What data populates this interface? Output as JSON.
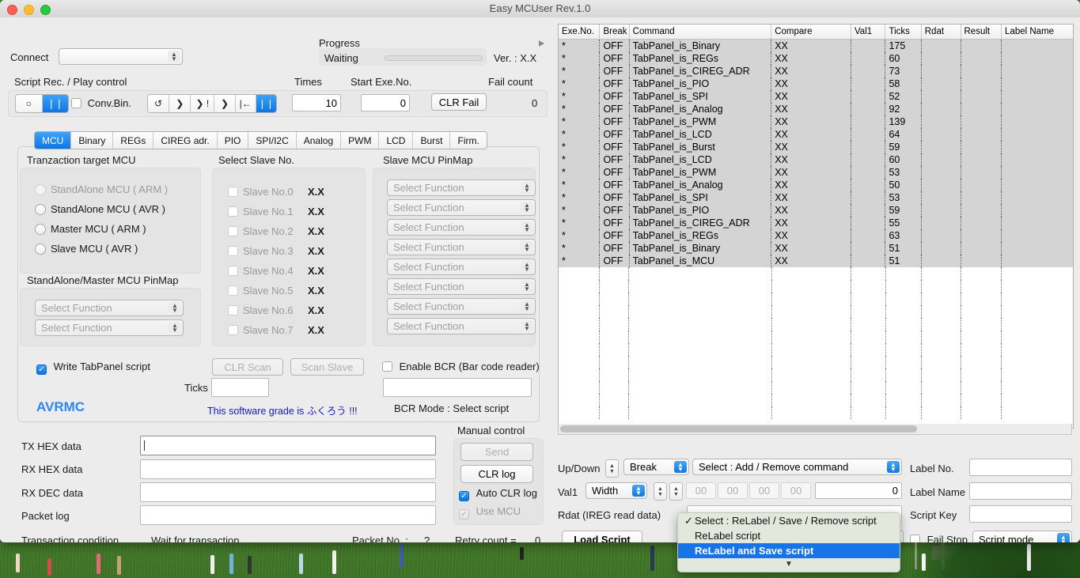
{
  "window": {
    "title": "Easy MCUser Rev.1.0"
  },
  "header": {
    "connect_label": "Connect",
    "connect_value": "",
    "progress_label": "Progress",
    "progress_status": "Waiting",
    "progress_percent": 0,
    "version": "Ver. : X.X",
    "disclosure_icon": "triangle-right-icon",
    "script_section_label": "Script Rec. / Play control",
    "times_label": "Times",
    "times_value": "10",
    "start_exe_label": "Start Exe.No.",
    "start_exe_value": "0",
    "fail_count_label": "Fail count",
    "fail_count_value": "0",
    "clr_fail_label": "CLR Fail",
    "conv_bin_label": "Conv.Bin.",
    "conv_bin_checked": false,
    "rec_segments": [
      "○",
      "❘❘"
    ],
    "rec_selected_index": 1,
    "play_segments": [
      "↺",
      "❯",
      "❯ !",
      "❯",
      "|←",
      "❘❘"
    ],
    "play_selected_index": 5
  },
  "tabs": {
    "items": [
      "MCU",
      "Binary",
      "REGs",
      "CIREG adr.",
      "PIO",
      "SPI/I2C",
      "Analog",
      "PWM",
      "LCD",
      "Burst",
      "Firm."
    ],
    "selected": "MCU"
  },
  "mcu_panel": {
    "target_label": "Tranzaction target MCU",
    "radios": [
      {
        "label": "StandAlone MCU ( ARM )",
        "enabled": false,
        "selected": false
      },
      {
        "label": "StandAlone MCU ( AVR )",
        "enabled": true,
        "selected": false
      },
      {
        "label": "Master MCU ( ARM )",
        "enabled": true,
        "selected": false
      },
      {
        "label": "Slave MCU ( AVR )",
        "enabled": true,
        "selected": false
      }
    ],
    "pinmap_label": "StandAlone/Master MCU PinMap",
    "pinmap_selects": [
      "Select Function",
      "Select Function"
    ],
    "slave_label": "Select Slave No.",
    "slaves": [
      {
        "label": "Slave No.0",
        "value": "X.X"
      },
      {
        "label": "Slave No.1",
        "value": "X.X"
      },
      {
        "label": "Slave No.2",
        "value": "X.X"
      },
      {
        "label": "Slave No.3",
        "value": "X.X"
      },
      {
        "label": "Slave No.4",
        "value": "X.X"
      },
      {
        "label": "Slave No.5",
        "value": "X.X"
      },
      {
        "label": "Slave No.6",
        "value": "X.X"
      },
      {
        "label": "Slave No.7",
        "value": "X.X"
      }
    ],
    "slave_pinmap_label": "Slave MCU PinMap",
    "slave_pinmap_selects": [
      "Select Function",
      "Select Function",
      "Select Function",
      "Select Function",
      "Select Function",
      "Select Function",
      "Select Function",
      "Select Function"
    ],
    "write_tabpanel_label": "Write TabPanel script",
    "write_tabpanel_checked": true,
    "clr_scan_label": "CLR Scan",
    "scan_slave_label": "Scan Slave",
    "ticks_label": "Ticks",
    "ticks_value": "",
    "enable_bcr_label": "Enable BCR (Bar code reader)",
    "enable_bcr_checked": false,
    "bcr_value": "",
    "bcr_mode_label": "BCR Mode : Select script",
    "brand": "AVRMC",
    "grade_note": "This software grade is ふくろう !!!"
  },
  "data_panel": {
    "tx_hex_label": "TX HEX data",
    "tx_hex_value": "",
    "rx_hex_label": "RX HEX data",
    "rx_hex_value": "",
    "rx_dec_label": "RX DEC data",
    "rx_dec_value": "",
    "packet_log_label": "Packet log",
    "packet_log_value": "",
    "transaction_condition_label": "Transaction condition",
    "transaction_condition_value": "Wait for transaction",
    "packet_no_label": "Packet No. :",
    "packet_no_value": "?",
    "retry_count_label": "Retry count  =",
    "retry_count_value": "0",
    "manual_control_label": "Manual control",
    "send_label": "Send",
    "clr_log_label": "CLR log",
    "auto_clr_log_label": "Auto CLR log",
    "auto_clr_log_checked": true,
    "use_mcu_label": "Use MCU",
    "use_mcu_checked": true
  },
  "script_table": {
    "columns": [
      "Exe.No.",
      "Break",
      "Command",
      "Compare",
      "Val1",
      "Ticks",
      "Rdat",
      "Result",
      "Label Name"
    ],
    "rows": [
      [
        "*",
        "OFF",
        "TabPanel_is_Binary",
        "XX",
        "",
        "175",
        "",
        "",
        ""
      ],
      [
        "*",
        "OFF",
        "TabPanel_is_REGs",
        "XX",
        "",
        "60",
        "",
        "",
        ""
      ],
      [
        "*",
        "OFF",
        "TabPanel_is_CIREG_ADR",
        "XX",
        "",
        "73",
        "",
        "",
        ""
      ],
      [
        "*",
        "OFF",
        "TabPanel_is_PIO",
        "XX",
        "",
        "58",
        "",
        "",
        ""
      ],
      [
        "*",
        "OFF",
        "TabPanel_is_SPI",
        "XX",
        "",
        "52",
        "",
        "",
        ""
      ],
      [
        "*",
        "OFF",
        "TabPanel_is_Analog",
        "XX",
        "",
        "92",
        "",
        "",
        ""
      ],
      [
        "*",
        "OFF",
        "TabPanel_is_PWM",
        "XX",
        "",
        "139",
        "",
        "",
        ""
      ],
      [
        "*",
        "OFF",
        "TabPanel_is_LCD",
        "XX",
        "",
        "64",
        "",
        "",
        ""
      ],
      [
        "*",
        "OFF",
        "TabPanel_is_Burst",
        "XX",
        "",
        "59",
        "",
        "",
        ""
      ],
      [
        "*",
        "OFF",
        "TabPanel_is_LCD",
        "XX",
        "",
        "60",
        "",
        "",
        ""
      ],
      [
        "*",
        "OFF",
        "TabPanel_is_PWM",
        "XX",
        "",
        "53",
        "",
        "",
        ""
      ],
      [
        "*",
        "OFF",
        "TabPanel_is_Analog",
        "XX",
        "",
        "50",
        "",
        "",
        ""
      ],
      [
        "*",
        "OFF",
        "TabPanel_is_SPI",
        "XX",
        "",
        "53",
        "",
        "",
        ""
      ],
      [
        "*",
        "OFF",
        "TabPanel_is_PIO",
        "XX",
        "",
        "59",
        "",
        "",
        ""
      ],
      [
        "*",
        "OFF",
        "TabPanel_is_CIREG_ADR",
        "XX",
        "",
        "55",
        "",
        "",
        ""
      ],
      [
        "*",
        "OFF",
        "TabPanel_is_REGs",
        "XX",
        "",
        "63",
        "",
        "",
        ""
      ],
      [
        "*",
        "OFF",
        "TabPanel_is_Binary",
        "XX",
        "",
        "51",
        "",
        "",
        ""
      ],
      [
        "*",
        "OFF",
        "TabPanel_is_MCU",
        "XX",
        "",
        "51",
        "",
        "",
        ""
      ]
    ],
    "hscroll_thumb_percent": 70
  },
  "script_controls": {
    "updown_label": "Up/Down",
    "break_select": "Break",
    "command_select": "Select : Add / Remove command",
    "label_no_label": "Label No.",
    "label_no_value": "",
    "val1_label": "Val1",
    "width_select": "Width",
    "byte_fields": [
      "00",
      "00",
      "00",
      "00"
    ],
    "val1_value": "0",
    "label_name_label": "Label Name",
    "label_name_value": "",
    "rdat_label": "Rdat (IREG read data)",
    "rdat_value": "",
    "script_key_label": "Script Key",
    "script_key_value": "",
    "load_script_label": "Load Script",
    "fail_stop_label": "Fail Stop",
    "fail_stop_checked": false,
    "script_mode_select": "Script mode"
  },
  "dropdown_menu": {
    "items": [
      {
        "label": "Select : ReLabel / Save / Remove script",
        "checked": true,
        "highlighted": false
      },
      {
        "label": "ReLabel script",
        "checked": false,
        "highlighted": false
      },
      {
        "label": "ReLabel and Save script",
        "checked": false,
        "highlighted": true
      }
    ],
    "more_icon": "triangle-down-icon"
  },
  "colors": {
    "accent": "#0d76e4",
    "selection": "#1873e8",
    "brand": "#2f86f0",
    "note": "#1515d0",
    "window_bg": "#ececec",
    "table_row_bg": "#d4d4d4"
  }
}
